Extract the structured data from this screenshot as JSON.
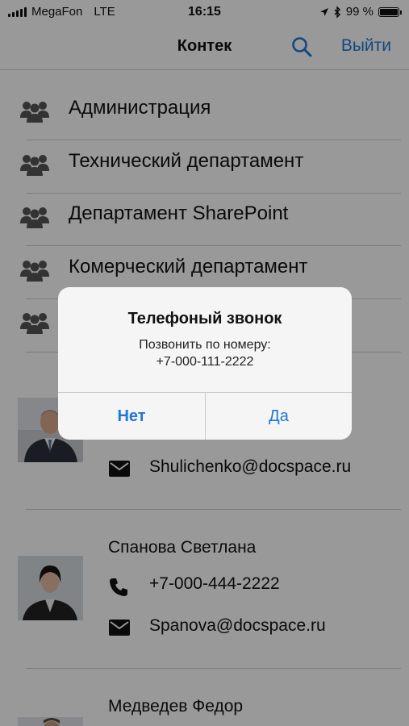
{
  "status_bar": {
    "carrier": "MegaFon",
    "network": "LTE",
    "time": "16:15",
    "battery": "99 %",
    "battery_level": 0.99
  },
  "nav": {
    "title": "Контек",
    "search_icon": "search-icon",
    "logout_label": "Выйти",
    "accent_color": "#1e78d7"
  },
  "departments": [
    {
      "label": "Администрация",
      "icon": "group-icon"
    },
    {
      "label": "Технический департамент",
      "icon": "group-icon"
    },
    {
      "label": "Департамент SharePoint",
      "icon": "group-icon"
    },
    {
      "label": "Комерческий департамент",
      "icon": "group-icon"
    },
    {
      "label": "",
      "icon": "group-icon"
    }
  ],
  "contacts": [
    {
      "name": "",
      "phone": "",
      "email": "Shulichenko@docspace.ru"
    },
    {
      "name": "Спанова Светлана",
      "phone": "+7-000-444-2222",
      "email": "Spanova@docspace.ru"
    },
    {
      "name": "Медведев Федор"
    }
  ],
  "alert": {
    "title": "Телефоный звонок",
    "message_line1": "Позвонить по номеру:",
    "message_line2": "+7-000-111-2222",
    "cancel_label": "Нет",
    "confirm_label": "Да"
  }
}
